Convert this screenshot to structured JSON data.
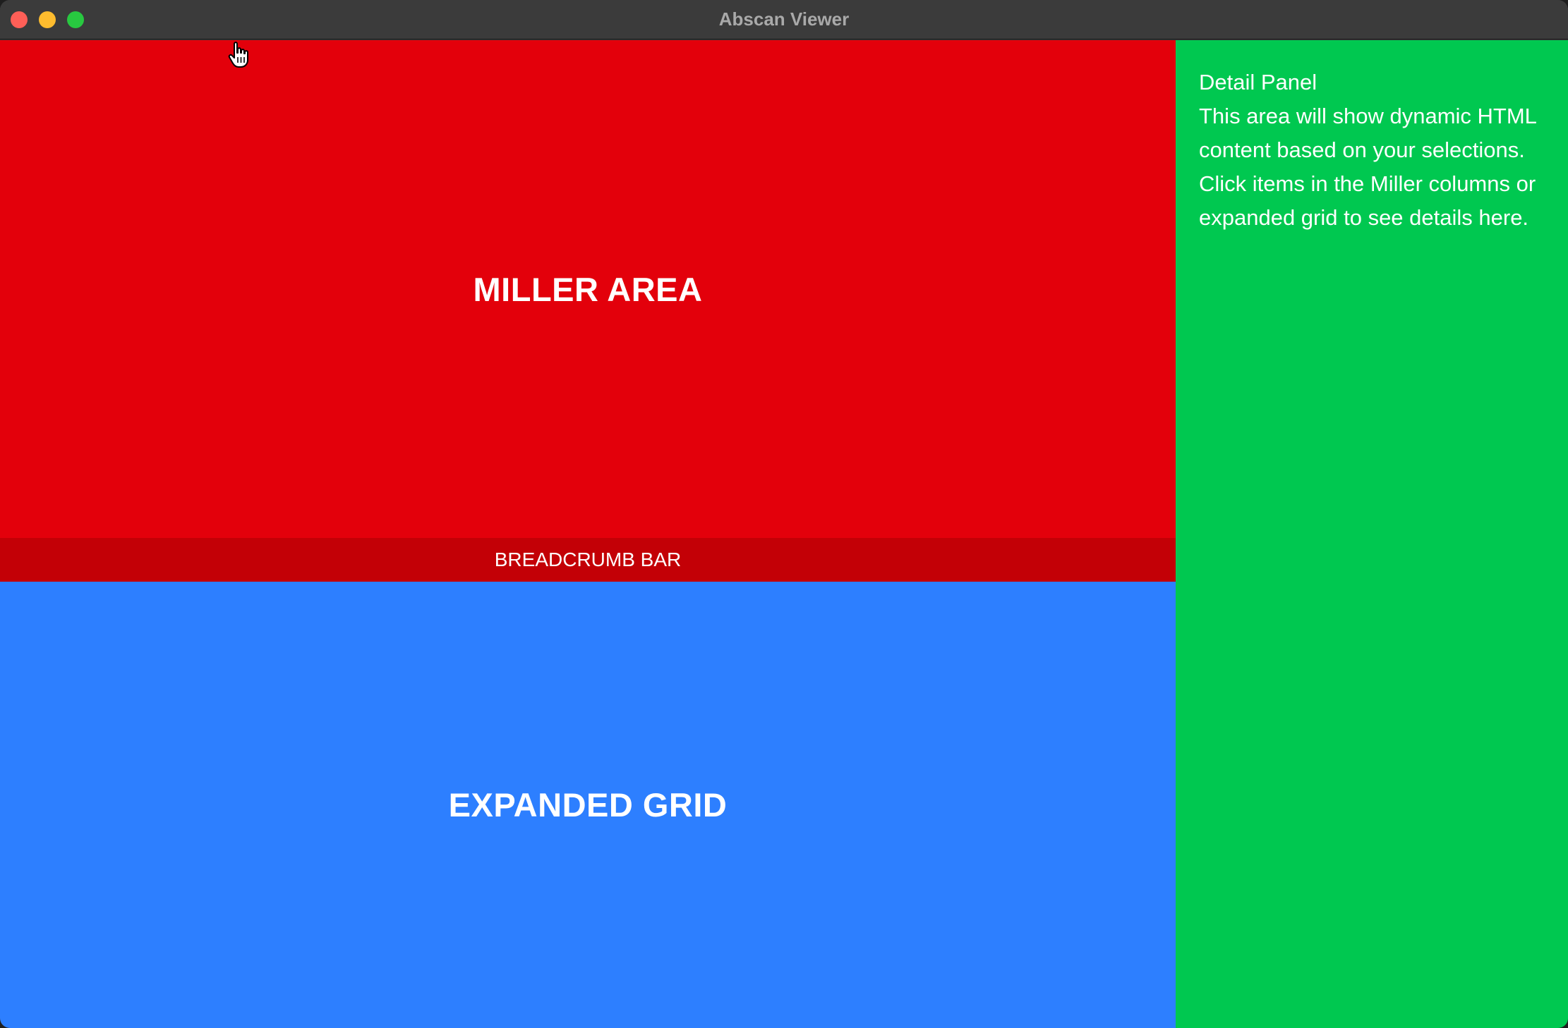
{
  "window": {
    "title": "Abscan Viewer"
  },
  "miller": {
    "label": "MILLER AREA"
  },
  "breadcrumb": {
    "label": "BREADCRUMB BAR"
  },
  "grid": {
    "label": "EXPANDED GRID"
  },
  "detail": {
    "title": "Detail Panel",
    "line1": "This area will show dynamic HTML content based on your selections.",
    "line2": "Click items in the Miller columns or expanded grid to see details here."
  },
  "colors": {
    "miller_bg": "#e3000b",
    "breadcrumb_bg": "#c30006",
    "grid_bg": "#2d7fff",
    "detail_bg": "#00c850"
  }
}
